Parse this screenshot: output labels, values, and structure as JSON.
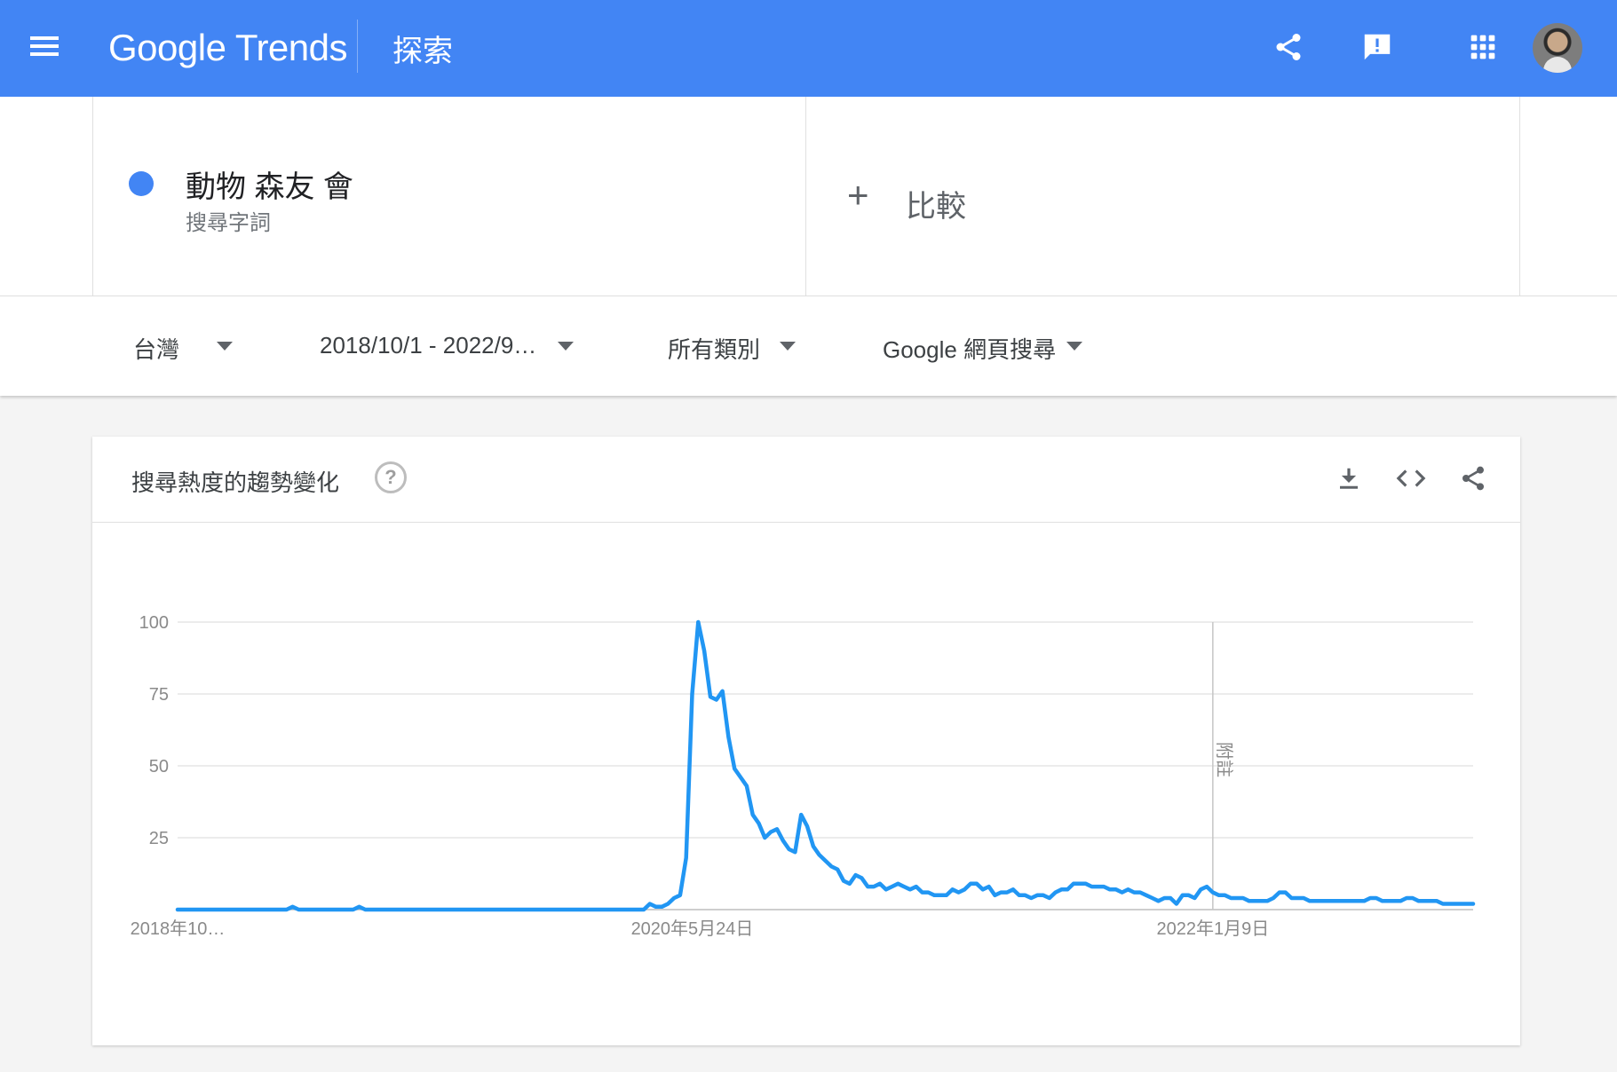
{
  "header": {
    "logo": "Google Trends",
    "page_title": "探索",
    "icons": [
      "menu-icon",
      "share-icon",
      "feedback-icon",
      "apps-grid-icon",
      "avatar"
    ]
  },
  "term": {
    "name": "動物 森友 會",
    "type": "搜尋字詞",
    "color": "#4285f4"
  },
  "compare": {
    "plus": "+",
    "label": "比較"
  },
  "filters": {
    "region": "台灣",
    "date_range": "2018/10/1 - 2022/9…",
    "category": "所有類別",
    "search_type": "Google 網頁搜尋"
  },
  "chart_card": {
    "title": "搜尋熱度的趨勢變化",
    "help": "?",
    "icons": [
      "download-icon",
      "embed-code-icon",
      "share-icon"
    ]
  },
  "chart_data": {
    "type": "line",
    "title": "",
    "xlabel": "",
    "ylabel": "",
    "ylim": [
      0,
      100
    ],
    "y_ticks": [
      25,
      50,
      75,
      100
    ],
    "x_tick_labels": [
      {
        "index": 0,
        "label": "2018年10…"
      },
      {
        "index": 85,
        "label": "2020年5月24日"
      },
      {
        "index": 171,
        "label": "2022年1月9日"
      }
    ],
    "annotation": {
      "index": 171,
      "label": "附註"
    },
    "grid": true,
    "series": [
      {
        "color": "#2196f3",
        "values": [
          0,
          0,
          0,
          0,
          0,
          0,
          0,
          0,
          0,
          0,
          0,
          0,
          0,
          0,
          0,
          0,
          0,
          0,
          0,
          1,
          0,
          0,
          0,
          0,
          0,
          0,
          0,
          0,
          0,
          0,
          1,
          0,
          0,
          0,
          0,
          0,
          0,
          0,
          0,
          0,
          0,
          0,
          0,
          0,
          0,
          0,
          0,
          0,
          0,
          0,
          0,
          0,
          0,
          0,
          0,
          0,
          0,
          0,
          0,
          0,
          0,
          0,
          0,
          0,
          0,
          0,
          0,
          0,
          0,
          0,
          0,
          0,
          0,
          0,
          0,
          0,
          0,
          0,
          2,
          1,
          1,
          2,
          4,
          5,
          18,
          75,
          100,
          90,
          74,
          73,
          76,
          60,
          49,
          46,
          43,
          33,
          30,
          25,
          27,
          28,
          24,
          21,
          20,
          33,
          29,
          22,
          19,
          17,
          15,
          14,
          10,
          9,
          12,
          11,
          8,
          8,
          9,
          7,
          8,
          9,
          8,
          7,
          8,
          6,
          6,
          5,
          5,
          5,
          7,
          6,
          7,
          9,
          9,
          7,
          8,
          5,
          6,
          6,
          7,
          5,
          5,
          4,
          5,
          5,
          4,
          6,
          7,
          7,
          9,
          9,
          9,
          8,
          8,
          8,
          7,
          7,
          6,
          7,
          6,
          6,
          5,
          4,
          3,
          4,
          4,
          2,
          5,
          5,
          4,
          7,
          8,
          6,
          5,
          5,
          4,
          4,
          4,
          3,
          3,
          3,
          3,
          4,
          6,
          6,
          4,
          4,
          4,
          3,
          3,
          3,
          3,
          3,
          3,
          3,
          3,
          3,
          3,
          4,
          4,
          3,
          3,
          3,
          3,
          4,
          4,
          3,
          3,
          3,
          3,
          2,
          2,
          2,
          2,
          2,
          2
        ]
      }
    ]
  }
}
